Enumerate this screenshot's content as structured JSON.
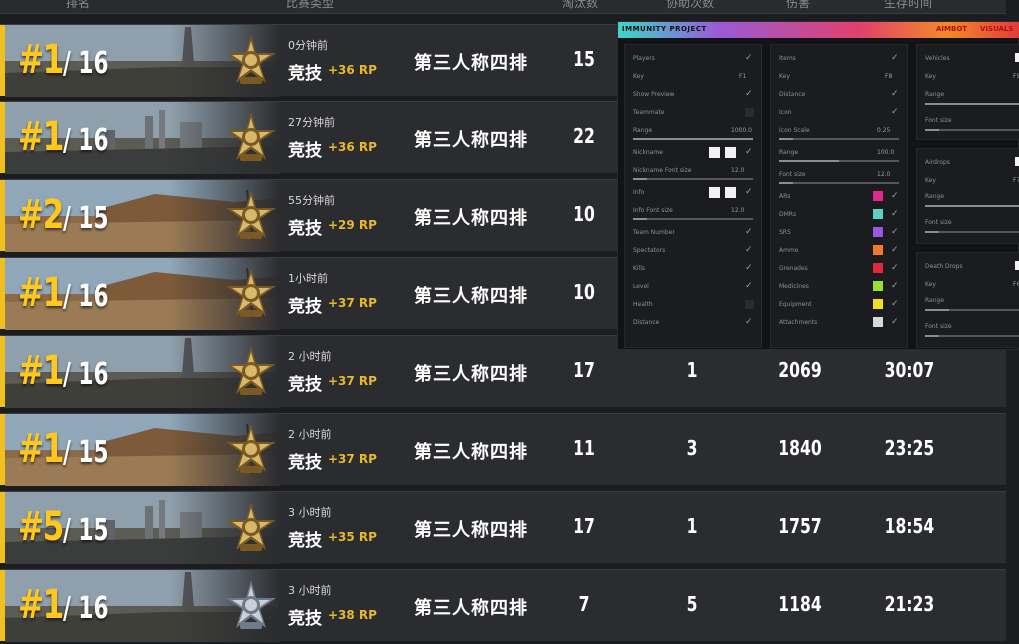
{
  "header": {
    "columns": [
      "排名",
      "比赛类型",
      "淘汰数",
      "协助次数",
      "伤害",
      "生存时间"
    ]
  },
  "rows": [
    {
      "place": "#1",
      "total": "/ 16",
      "time": "0分钟前",
      "mode": "竞技",
      "rp": "+36 RP",
      "queue": "第三人称四排",
      "kills": "15",
      "assists": "",
      "damage": "",
      "survival": "",
      "map": "erangel"
    },
    {
      "place": "#1",
      "total": "/ 16",
      "time": "27分钟前",
      "mode": "竞技",
      "rp": "+36 RP",
      "queue": "第三人称四排",
      "kills": "22",
      "assists": "",
      "damage": "",
      "survival": "",
      "map": "erangel-city"
    },
    {
      "place": "#2",
      "total": "/ 15",
      "time": "55分钟前",
      "mode": "竞技",
      "rp": "+29 RP",
      "queue": "第三人称四排",
      "kills": "10",
      "assists": "",
      "damage": "",
      "survival": "",
      "map": "miramar"
    },
    {
      "place": "#1",
      "total": "/ 16",
      "time": "1小时前",
      "mode": "竞技",
      "rp": "+37 RP",
      "queue": "第三人称四排",
      "kills": "10",
      "assists": "",
      "damage": "",
      "survival": "",
      "map": "miramar"
    },
    {
      "place": "#1",
      "total": "/ 16",
      "time": "2 小时前",
      "mode": "竞技",
      "rp": "+37 RP",
      "queue": "第三人称四排",
      "kills": "17",
      "assists": "1",
      "damage": "2069",
      "survival": "30:07",
      "map": "erangel"
    },
    {
      "place": "#1",
      "total": "/ 15",
      "time": "2 小时前",
      "mode": "竞技",
      "rp": "+37 RP",
      "queue": "第三人称四排",
      "kills": "11",
      "assists": "3",
      "damage": "1840",
      "survival": "23:25",
      "map": "miramar"
    },
    {
      "place": "#5",
      "total": "/ 15",
      "time": "3 小时前",
      "mode": "竞技",
      "rp": "+35 RP",
      "queue": "第三人称四排",
      "kills": "17",
      "assists": "1",
      "damage": "1757",
      "survival": "18:54",
      "map": "erangel-city"
    },
    {
      "place": "#1",
      "total": "/ 16",
      "time": "3 小时前",
      "mode": "竞技",
      "rp": "+38 RP",
      "queue": "第三人称四排",
      "kills": "7",
      "assists": "5",
      "damage": "1184",
      "survival": "21:23",
      "map": "erangel"
    }
  ],
  "overlay": {
    "title": "IMMUNITY PROJECT",
    "tabs": [
      "AIMBOT",
      "VISUALS"
    ],
    "players": {
      "items": [
        {
          "label": "Players",
          "type": "check",
          "value": true
        },
        {
          "label": "Key",
          "type": "key",
          "value": "F1"
        },
        {
          "label": "Show Preview",
          "type": "check",
          "value": true
        },
        {
          "label": "Teammate",
          "type": "check",
          "value": false
        },
        {
          "label": "Range",
          "type": "slider",
          "value": "1000.0"
        },
        {
          "label": "Nickname",
          "type": "colors-check",
          "value": true
        },
        {
          "label": "Nickname Font size",
          "type": "slider",
          "value": "12.0"
        },
        {
          "label": "Info",
          "type": "colors-check",
          "value": true
        },
        {
          "label": "Info Font size",
          "type": "slider",
          "value": "12.0"
        },
        {
          "label": "Team Number",
          "type": "check",
          "value": true
        },
        {
          "label": "Spectators",
          "type": "check",
          "value": true
        },
        {
          "label": "Kills",
          "type": "check",
          "value": true
        },
        {
          "label": "Level",
          "type": "check",
          "value": true
        },
        {
          "label": "Health",
          "type": "check",
          "value": false
        },
        {
          "label": "Distance",
          "type": "check",
          "value": true
        }
      ]
    },
    "items": {
      "items": [
        {
          "label": "Items",
          "type": "check",
          "value": true
        },
        {
          "label": "Key",
          "type": "key",
          "value": "F8"
        },
        {
          "label": "Distance",
          "type": "check",
          "value": true
        },
        {
          "label": "Icon",
          "type": "check",
          "value": true
        },
        {
          "label": "Icon Scale",
          "type": "slider",
          "value": "0.25"
        },
        {
          "label": "Range",
          "type": "slider",
          "value": "100.0"
        },
        {
          "label": "Font size",
          "type": "slider",
          "value": "12.0"
        },
        {
          "label": "ARs",
          "type": "swatch",
          "color": "#e0288a"
        },
        {
          "label": "DMRs",
          "type": "swatch",
          "color": "#5fd0c8"
        },
        {
          "label": "SRS",
          "type": "swatch",
          "color": "#9a58e0"
        },
        {
          "label": "Ammo",
          "type": "swatch",
          "color": "#f07a28"
        },
        {
          "label": "Grenades",
          "type": "swatch",
          "color": "#e02a3a"
        },
        {
          "label": "Medicines",
          "type": "swatch",
          "color": "#9ae030"
        },
        {
          "label": "Equipment",
          "type": "swatch",
          "color": "#f2e020"
        },
        {
          "label": "Attachments",
          "type": "swatch",
          "color": "#d8d8d8"
        }
      ]
    },
    "vehicles": {
      "labels": [
        "Vehicles",
        "Key",
        "Range",
        "Font size"
      ],
      "key": "F9"
    },
    "airdrops": {
      "labels": [
        "Airdrops",
        "Key",
        "Range",
        "Font size"
      ],
      "key": "F7"
    },
    "deathdrops": {
      "labels": [
        "Death Drops",
        "Key",
        "Range",
        "Font size"
      ],
      "key": "F6"
    }
  }
}
